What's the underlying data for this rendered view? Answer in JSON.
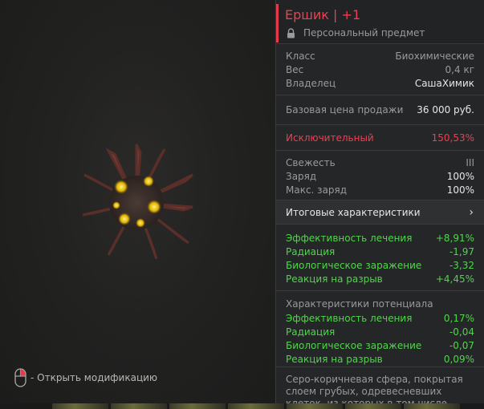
{
  "preview": {
    "hint_text": "- Открыть модификацию",
    "artifact_icon": "spiky-sphere-artifact",
    "mouse_icon": "mouse-right-click-icon"
  },
  "item": {
    "title": "Ершик | +1",
    "personal_label": "Персональный предмет",
    "lock_icon": "lock-icon",
    "accent_color": "#ee3f52"
  },
  "info": [
    {
      "label": "Класс",
      "value": "Биохимические"
    },
    {
      "label": "Вес",
      "value": "0,4 кг"
    },
    {
      "label": "Владелец",
      "value": "СашаХимик"
    }
  ],
  "price": {
    "label": "Базовая цена продажи",
    "value": "36 000 руб."
  },
  "rarity": {
    "label": "Исключительный",
    "value": "150,53%"
  },
  "status": [
    {
      "label": "Свежесть",
      "value": "III"
    },
    {
      "label": "Заряд",
      "value": "100%"
    },
    {
      "label": "Макс. заряд",
      "value": "100%"
    }
  ],
  "totals_toggle": {
    "label": "Итоговые характеристики",
    "chevron": "›"
  },
  "totals": [
    {
      "label": "Эффективность лечения",
      "value": "+8,91%"
    },
    {
      "label": "Радиация",
      "value": "-1,97"
    },
    {
      "label": "Биологическое заражение",
      "value": "-3,32"
    },
    {
      "label": "Реакция на разрыв",
      "value": "+4,45%"
    }
  ],
  "potential": {
    "heading": "Характеристики потенциала",
    "rows": [
      {
        "label": "Эффективность лечения",
        "value": "0,17%"
      },
      {
        "label": "Радиация",
        "value": "-0,04"
      },
      {
        "label": "Биологическое заражение",
        "value": "-0,07"
      },
      {
        "label": "Реакция на разрыв",
        "value": "0,09%"
      }
    ]
  },
  "description": "Серо-коричневая сфера, покрытая слоем грубых, одревесневших клеток, из которых в том числе состоят"
}
